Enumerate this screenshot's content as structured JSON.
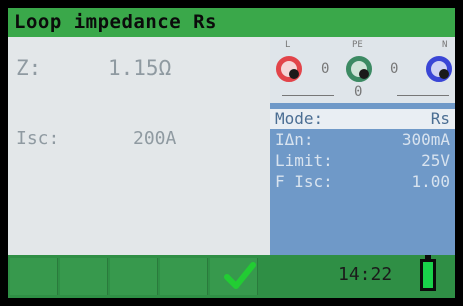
{
  "header": {
    "title": "Loop impedance Rs"
  },
  "measurements": {
    "z_label": "Z:",
    "z_value": "1.15Ω",
    "isc_label": "Isc:",
    "isc_value": "200A"
  },
  "terminals": {
    "l_label": "L",
    "pe_label": "PE",
    "n_label": "N",
    "l_pe_value": "0",
    "pe_n_value": "0",
    "l_n_value": "0"
  },
  "parameters": [
    {
      "label": "Mode:",
      "value": "Rs",
      "selected": true
    },
    {
      "label": "IΔn:",
      "value": "300mA",
      "selected": false
    },
    {
      "label": "Limit:",
      "value": "25V",
      "selected": false
    },
    {
      "label": "F Isc:",
      "value": "1.00",
      "selected": false
    }
  ],
  "status": {
    "time": "14:22",
    "result": "pass",
    "battery_level": 1.0
  },
  "colors": {
    "title_green": "#3aa84a",
    "param_blue": "#6f99c8",
    "check_green": "#22cc33",
    "terminal_l": "#e2444a",
    "terminal_pe": "#3c8a63",
    "terminal_n": "#3a46d6"
  }
}
